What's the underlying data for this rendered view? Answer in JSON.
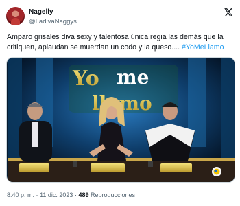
{
  "tweet": {
    "author": {
      "display_name": "Nagelly",
      "handle": "@LadivaNaggys"
    },
    "text_plain": "Amparo grisales diva sexy y talentosa única regia las demás que la critiquen, aplaudan se muerdan un codo y la queso.... ",
    "hashtag": "#YoMeLlamo",
    "media": {
      "show_title_top": "Yo",
      "show_title_mid": "me",
      "show_title_bottom": "llamo",
      "channel_logo": "caracol-logo"
    },
    "time": "8:40 p. m.",
    "separator": "·",
    "date": "11 dic. 2023",
    "views_count": "489",
    "views_label": "Reproducciones"
  },
  "icons": {
    "brand": "x-logo"
  },
  "colors": {
    "text": "#0f1419",
    "secondary": "#536471",
    "link": "#1d9bf0"
  }
}
